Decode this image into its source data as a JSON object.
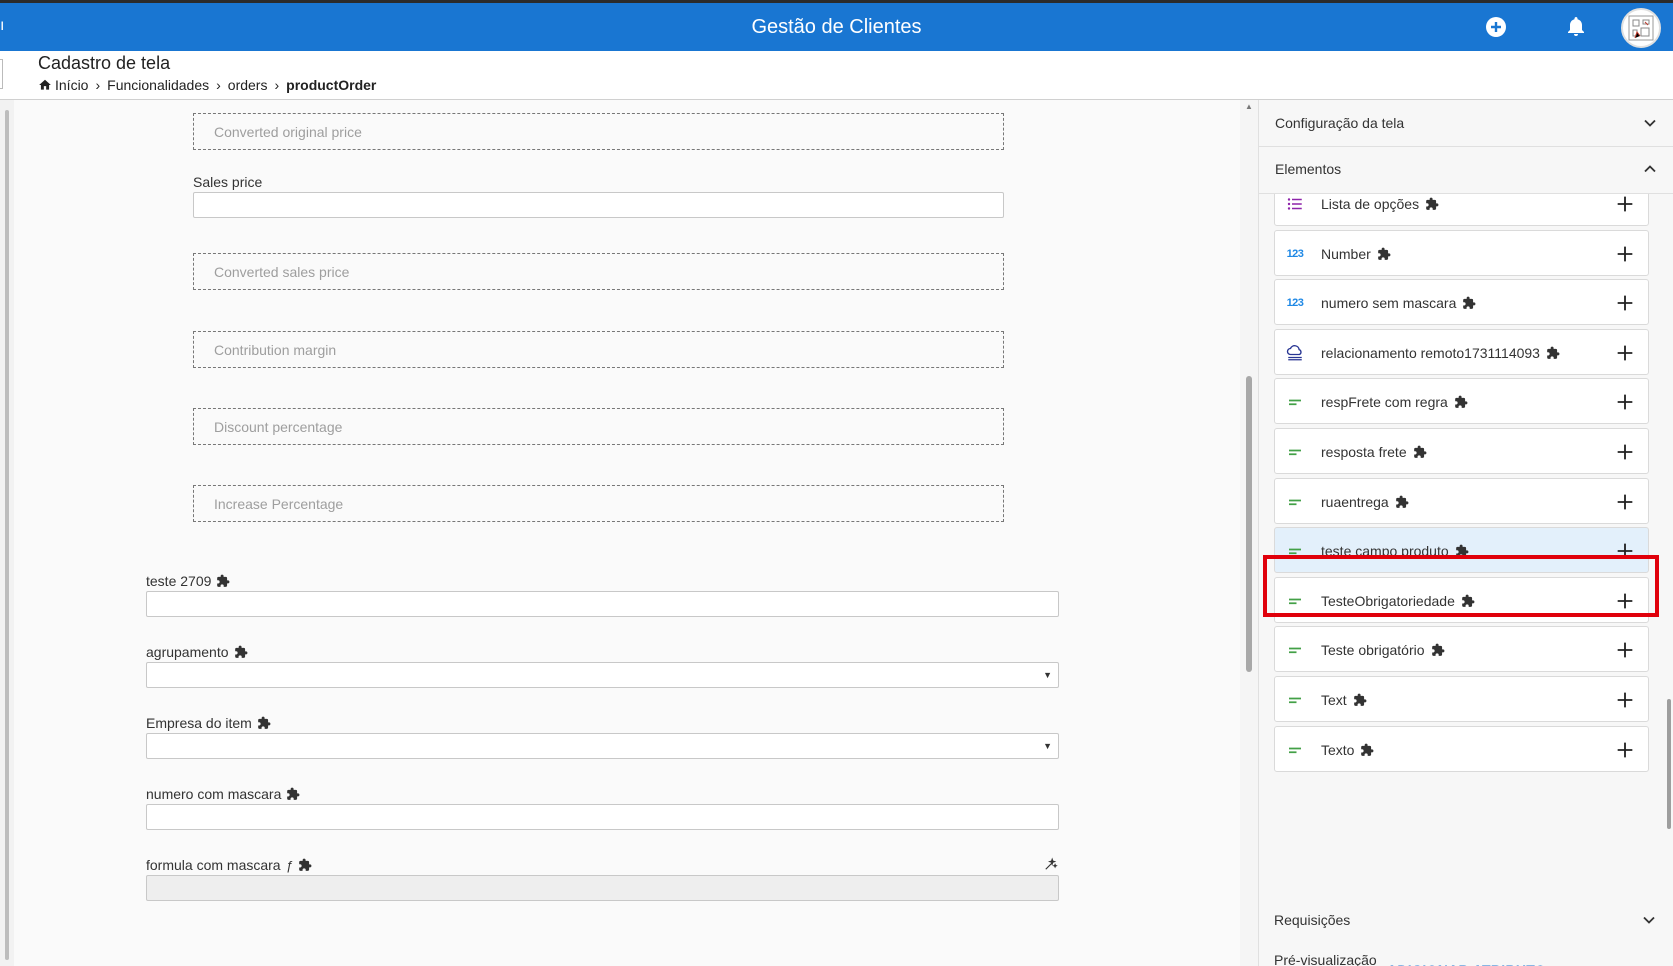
{
  "appbar": {
    "menu_fragment": "ı",
    "title": "Gestão de Clientes",
    "add_icon": "plus-circle-icon",
    "bell_icon": "bell-icon"
  },
  "header": {
    "page_title": "Cadastro de tela",
    "breadcrumb": [
      "Início",
      "Funcionalidades",
      "orders",
      "productOrder"
    ]
  },
  "form": {
    "converted_original_price": "Converted original price",
    "sales_price_label": "Sales price",
    "converted_sales_price": "Converted sales price",
    "contribution_margin": "Contribution margin",
    "discount_percentage": "Discount percentage",
    "increase_percentage": "Increase Percentage",
    "teste_2709_label": "teste 2709",
    "agrupamento_label": "agrupamento",
    "empresa_do_item_label": "Empresa do item",
    "numero_com_mascara_label": "numero com mascara",
    "formula_com_mascara_label": "formula com mascara",
    "formula_glyph": "ƒ"
  },
  "sidebar": {
    "config_label": "Configuração da tela",
    "elementos_label": "Elementos",
    "items": [
      {
        "label": "Lista de opções",
        "icon": "list-icon"
      },
      {
        "label": "Number",
        "icon": "number-123-icon"
      },
      {
        "label": "numero sem mascara",
        "icon": "number-123-icon"
      },
      {
        "label": "relacionamento remoto1731114093",
        "icon": "cloud-link-icon"
      },
      {
        "label": "respFrete com regra",
        "icon": "short-text-icon"
      },
      {
        "label": "resposta frete",
        "icon": "short-text-icon"
      },
      {
        "label": "ruaentrega",
        "icon": "short-text-icon"
      },
      {
        "label": "teste campo produto",
        "icon": "short-text-icon"
      },
      {
        "label": "TesteObrigatoriedade",
        "icon": "short-text-icon"
      },
      {
        "label": "Teste obrigatório",
        "icon": "short-text-icon"
      },
      {
        "label": "Text",
        "icon": "short-text-icon"
      },
      {
        "label": "Texto",
        "icon": "short-text-icon"
      }
    ],
    "add_attribute": "ADICIONAR ATRIBUTO",
    "requisicoes_label": "Requisições",
    "pre_visualizacao_label": "Pré-visualização"
  },
  "colors": {
    "appbar": "#1976d2",
    "highlight": "#e0000b",
    "text_icon": "#43a047",
    "number_icon": "#1e88e5",
    "list_icon": "#8e24aa"
  }
}
